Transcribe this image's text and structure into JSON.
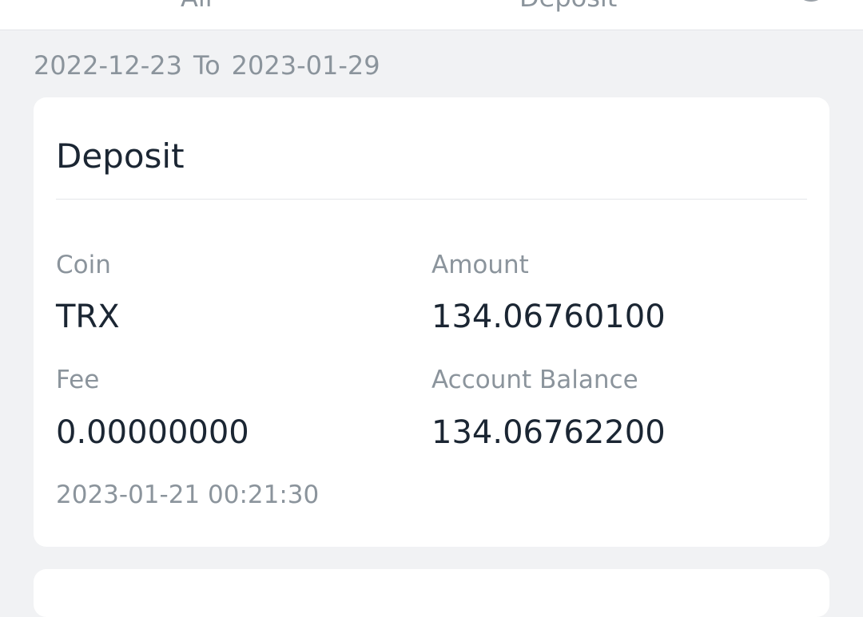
{
  "tabs": [
    {
      "label": "All"
    },
    {
      "label": "Deposit"
    }
  ],
  "date_range": {
    "start": "2022-12-23",
    "separator": "To",
    "end": "2023-01-29"
  },
  "record": {
    "title": "Deposit",
    "coin_label": "Coin",
    "coin_value": "TRX",
    "amount_label": "Amount",
    "amount_value": "134.06760100",
    "fee_label": "Fee",
    "fee_value": "0.00000000",
    "balance_label": "Account Balance",
    "balance_value": "134.06762200",
    "timestamp": "2023-01-21 00:21:30"
  },
  "icons": {
    "filter": "filter-icon"
  },
  "colors": {
    "background": "#f1f2f4",
    "card": "#ffffff",
    "primary_text": "#1b2633",
    "secondary_text": "#8b949c"
  }
}
